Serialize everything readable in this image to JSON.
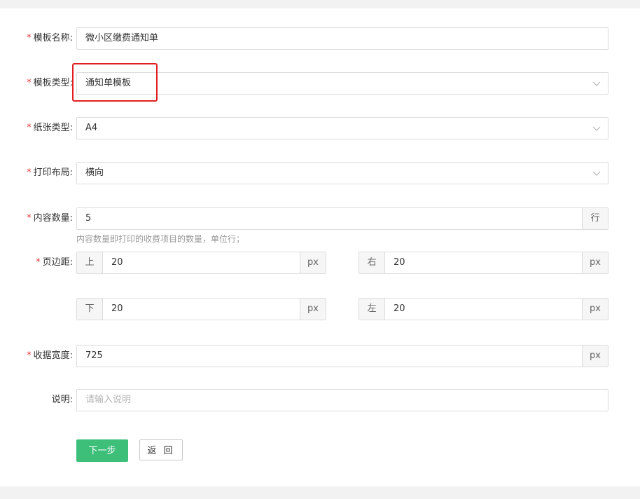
{
  "form": {
    "template_name": {
      "required_mark": "*",
      "label": "模板名称:",
      "value": "微小区缴费通知单"
    },
    "template_type": {
      "required_mark": "*",
      "label": "模板类型:",
      "value": "通知单模板",
      "icon": "chevron-down-icon"
    },
    "paper_type": {
      "required_mark": "*",
      "label": "纸张类型:",
      "value": "A4",
      "icon": "chevron-down-icon"
    },
    "print_layout": {
      "required_mark": "*",
      "label": "打印布局:",
      "value": "横向",
      "icon": "chevron-down-icon"
    },
    "content_count": {
      "required_mark": "*",
      "label": "内容数量:",
      "value": "5",
      "suffix": "行",
      "hint": "内容数量即打印的收费项目的数量，单位行；"
    },
    "page_margin": {
      "required_mark": "*",
      "label": "页边距:",
      "top": {
        "prefix": "上",
        "value": "20",
        "suffix": "px"
      },
      "right": {
        "prefix": "右",
        "value": "20",
        "suffix": "px"
      },
      "bottom": {
        "prefix": "下",
        "value": "20",
        "suffix": "px"
      },
      "left": {
        "prefix": "左",
        "value": "20",
        "suffix": "px"
      }
    },
    "receipt_width": {
      "required_mark": "*",
      "label": "收据宽度:",
      "value": "725",
      "suffix": "px"
    },
    "description": {
      "label": "说明:",
      "value": "",
      "placeholder": "请输入说明"
    }
  },
  "actions": {
    "next_label": "下一步",
    "back_label": "返 回"
  },
  "colors": {
    "required": "#e4393c",
    "primary_button": "#3dbf7a",
    "highlight_box": "#e02020",
    "border": "#dcdcdc"
  }
}
